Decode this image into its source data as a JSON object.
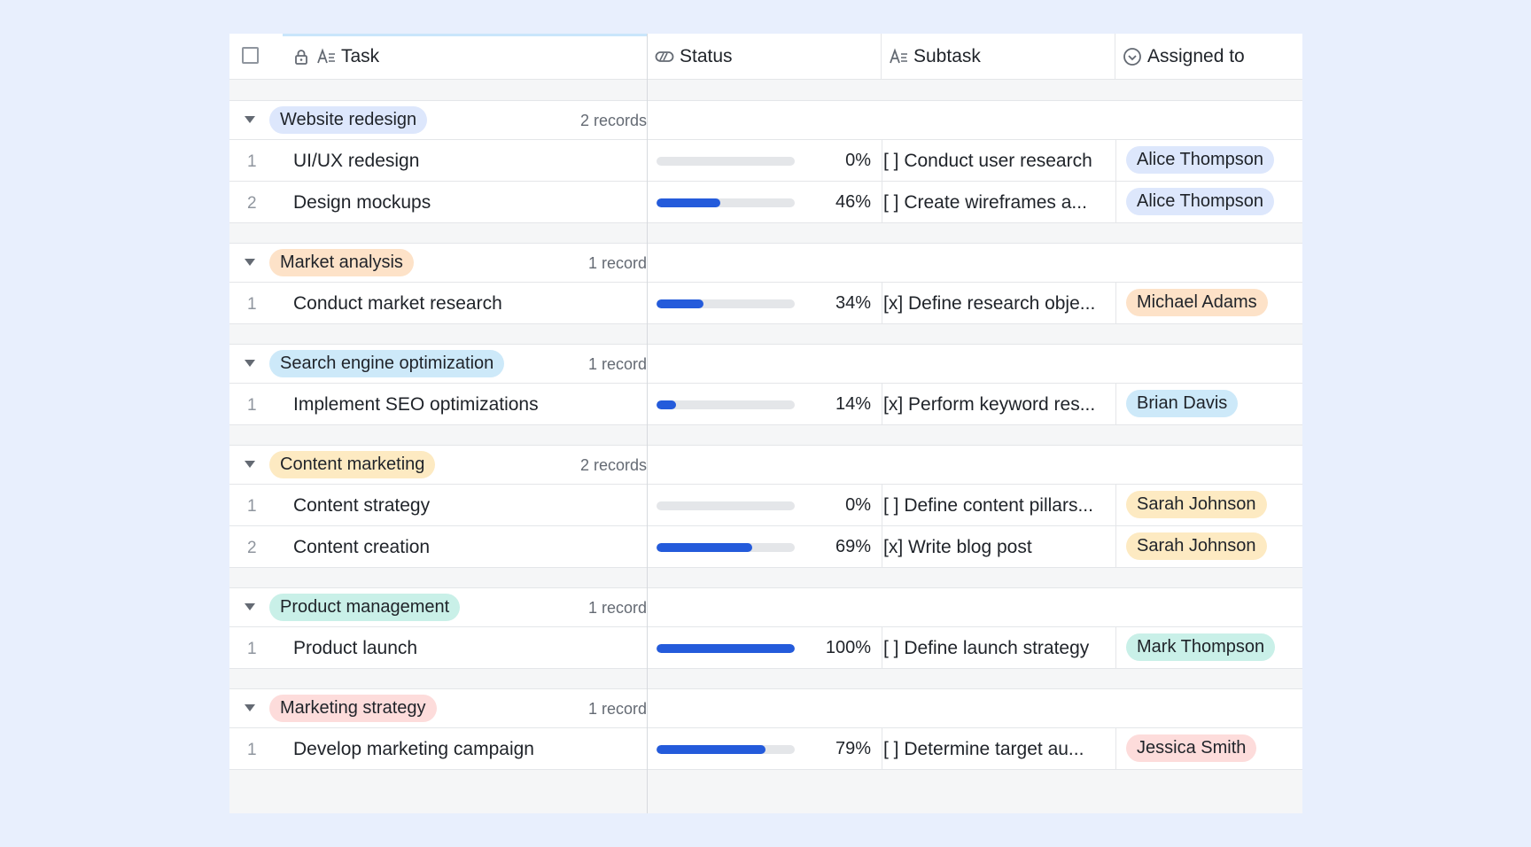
{
  "header": {
    "columns": [
      {
        "label": "Task",
        "icon": "text-field-icon"
      },
      {
        "label": "Status",
        "icon": "progress-field-icon"
      },
      {
        "label": "Subtask",
        "icon": "text-field-icon"
      },
      {
        "label": "Assigned to",
        "icon": "person-field-icon"
      }
    ]
  },
  "groups": [
    {
      "name": "Website redesign",
      "count": "2 records",
      "color": "#dde7fc",
      "records": [
        {
          "index": "1",
          "task": "UI/UX redesign",
          "progress": 0,
          "progress_label": "0%",
          "subtask": "[ ] Conduct user research",
          "assignee": "Alice Thompson",
          "assignee_color": "#dde7fc"
        },
        {
          "index": "2",
          "task": "Design mockups",
          "progress": 46,
          "progress_label": "46%",
          "subtask": "[ ] Create wireframes a...",
          "assignee": "Alice Thompson",
          "assignee_color": "#dde7fc"
        }
      ]
    },
    {
      "name": "Market analysis",
      "count": "1 record",
      "color": "#fde2c8",
      "records": [
        {
          "index": "1",
          "task": "Conduct market research",
          "progress": 34,
          "progress_label": "34%",
          "subtask": "[x] Define research obje...",
          "assignee": "Michael Adams",
          "assignee_color": "#fde2c8"
        }
      ]
    },
    {
      "name": "Search engine optimization",
      "count": "1 record",
      "color": "#cde9f9",
      "records": [
        {
          "index": "1",
          "task": "Implement SEO optimizations",
          "progress": 14,
          "progress_label": "14%",
          "subtask": "[x] Perform keyword res...",
          "assignee": "Brian Davis",
          "assignee_color": "#cde9f9"
        }
      ]
    },
    {
      "name": "Content marketing",
      "count": "2 records",
      "color": "#fdeac2",
      "records": [
        {
          "index": "1",
          "task": "Content strategy",
          "progress": 0,
          "progress_label": "0%",
          "subtask": "[ ] Define content pillars...",
          "assignee": "Sarah Johnson",
          "assignee_color": "#fdeac2"
        },
        {
          "index": "2",
          "task": "Content creation",
          "progress": 69,
          "progress_label": "69%",
          "subtask": "[x] Write blog post",
          "assignee": "Sarah Johnson",
          "assignee_color": "#fdeac2"
        }
      ]
    },
    {
      "name": "Product management",
      "count": "1 record",
      "color": "#c9f0e8",
      "records": [
        {
          "index": "1",
          "task": "Product launch",
          "progress": 100,
          "progress_label": "100%",
          "subtask": "[ ] Define launch strategy",
          "assignee": "Mark Thompson",
          "assignee_color": "#c9f0e8"
        }
      ]
    },
    {
      "name": "Marketing strategy",
      "count": "1 record",
      "color": "#fddcdb",
      "records": [
        {
          "index": "1",
          "task": "Develop marketing campaign",
          "progress": 79,
          "progress_label": "79%",
          "subtask": "[ ] Determine target au...",
          "assignee": "Jessica Smith",
          "assignee_color": "#fddcdb"
        }
      ]
    }
  ]
}
